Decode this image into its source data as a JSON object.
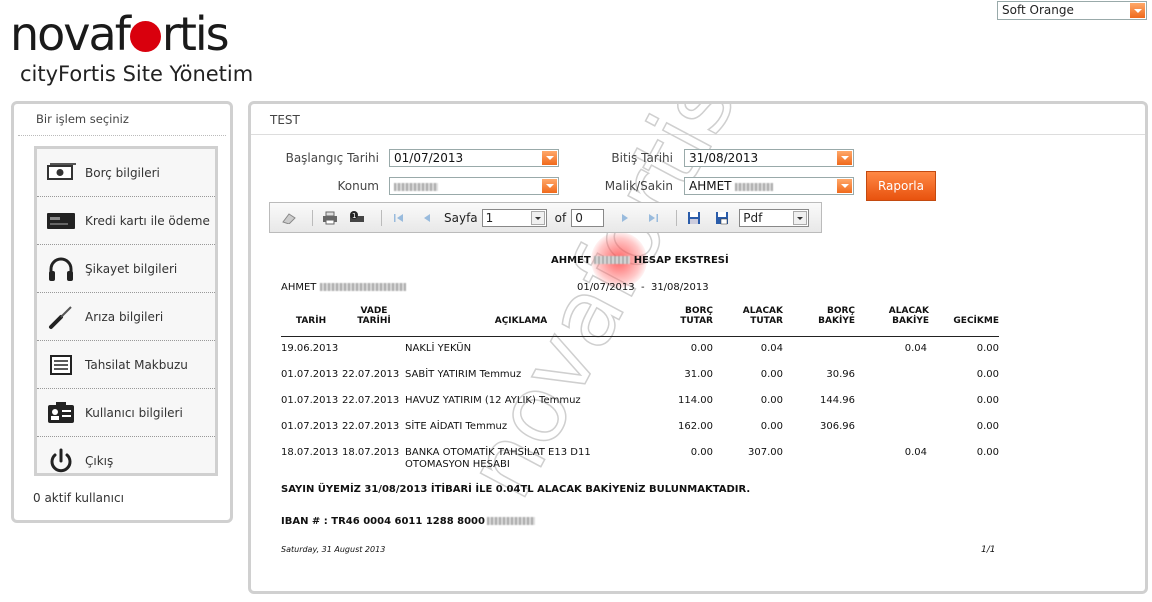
{
  "logo": {
    "brand_pre": "novaf",
    "brand_post": "rtis",
    "sub_light": "cityFortis",
    "sub_bold": "Site Yönetim"
  },
  "theme": {
    "selected": "Soft Orange"
  },
  "sidebar": {
    "header": "Bir işlem seçiniz",
    "items": [
      {
        "label": "Borç bilgileri",
        "icon": "money-icon"
      },
      {
        "label": "Kredi kartı ile ödeme",
        "icon": "credit-card-icon"
      },
      {
        "label": "Şikayet bilgileri",
        "icon": "headphones-icon"
      },
      {
        "label": "Arıza bilgileri",
        "icon": "screwdriver-icon"
      },
      {
        "label": "Tahsilat Makbuzu",
        "icon": "receipt-icon"
      },
      {
        "label": "Kullanıcı bilgileri",
        "icon": "id-card-icon"
      },
      {
        "label": "Çıkış",
        "icon": "power-icon"
      }
    ],
    "footer": "0 aktif kullanıcı"
  },
  "main": {
    "title": "TEST",
    "form": {
      "start_label": "Başlangıç Tarihi",
      "start_value": "01/07/2013",
      "end_label": "Bitiş Tarihi",
      "end_value": "31/08/2013",
      "location_label": "Konum",
      "owner_label": "Malik/Sakin",
      "owner_value": "AHMET",
      "report_button": "Raporla"
    },
    "toolbar": {
      "page_label": "Sayfa",
      "page_value": "1",
      "of_label": "of",
      "of_value": "0",
      "format": "Pdf"
    },
    "report": {
      "title_pre": "AHMET",
      "title_post": "HESAP EKSTRESİ",
      "customer": "AHMET",
      "period": "01/07/2013  -  31/08/2013",
      "columns": {
        "tarih": "TARİH",
        "vade1": "VADE",
        "vade2": "TARİHİ",
        "aciklama": "AÇIKLAMA",
        "borc1": "BORÇ",
        "borc2": "TUTAR",
        "alacak1": "ALACAK",
        "alacak2": "TUTAR",
        "borcb1": "BORÇ",
        "borcb2": "BAKİYE",
        "alacakb1": "ALACAK",
        "alacakb2": "BAKİYE",
        "gecikme": "GECİKME"
      },
      "rows": [
        {
          "tarih": "19.06.2013",
          "vade": "",
          "aciklama": "NAKLİ YEKÜN",
          "aciklama2": "",
          "borc": "0.00",
          "alacak": "0.04",
          "borc_b": "",
          "alacak_b": "0.04",
          "gecikme": "0.00"
        },
        {
          "tarih": "01.07.2013",
          "vade": "22.07.2013",
          "aciklama": "SABİT YATIRIM Temmuz",
          "aciklama2": "",
          "borc": "31.00",
          "alacak": "0.00",
          "borc_b": "30.96",
          "alacak_b": "",
          "gecikme": "0.00"
        },
        {
          "tarih": "01.07.2013",
          "vade": "22.07.2013",
          "aciklama": "HAVUZ YATIRIM (12 AYLIK) Temmuz",
          "aciklama2": "",
          "borc": "114.00",
          "alacak": "0.00",
          "borc_b": "144.96",
          "alacak_b": "",
          "gecikme": "0.00"
        },
        {
          "tarih": "01.07.2013",
          "vade": "22.07.2013",
          "aciklama": "SİTE AİDATI Temmuz",
          "aciklama2": "",
          "borc": "162.00",
          "alacak": "0.00",
          "borc_b": "306.96",
          "alacak_b": "",
          "gecikme": "0.00"
        },
        {
          "tarih": "18.07.2013",
          "vade": "18.07.2013",
          "aciklama": "BANKA OTOMATİK TAHSİLAT E13 D11",
          "aciklama2": "OTOMASYON HESABI",
          "borc": "0.00",
          "alacak": "307.00",
          "borc_b": "",
          "alacak_b": "0.04",
          "gecikme": "0.00"
        }
      ],
      "notice": "SAYIN ÜYEMİZ 31/08/2013 İTİBARİ İLE 0.04TL ALACAK BAKİYENİZ BULUNMAKTADIR.",
      "iban": "IBAN # : TR46 0004 6011 1288 8000",
      "date_footer": "Saturday, 31 August 2013",
      "page_footer": "1/1"
    },
    "watermark": "novafortis"
  },
  "colors": {
    "accent": "#f06a1c",
    "brand_red": "#d9000d",
    "border": "#d0d0d0"
  }
}
